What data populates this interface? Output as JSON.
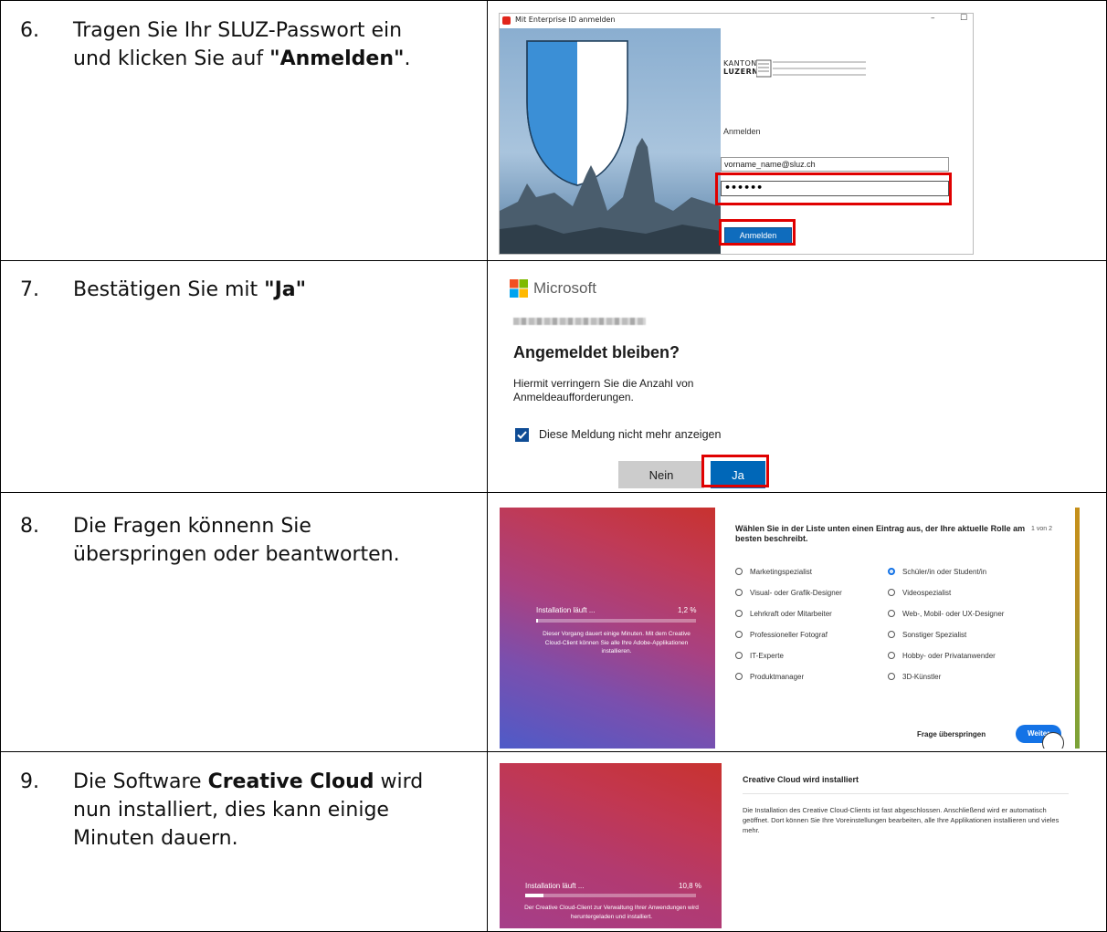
{
  "steps": [
    {
      "num": "6.",
      "pre": "Tragen Sie Ihr SLUZ-Passwort ein und klicken Sie auf ",
      "bold": "\"Anmelden\"",
      "post": "."
    },
    {
      "num": "7.",
      "pre": "Bestätigen Sie mit ",
      "bold": "\"Ja\"",
      "post": ""
    },
    {
      "num": "8.",
      "pre": "Die Fragen könnenn Sie überspringen oder beantworten.",
      "bold": "",
      "post": ""
    },
    {
      "num": "9.",
      "pre": "Die Software ",
      "bold": "Creative Cloud",
      "post": " wird nun installiert, dies kann einige Minuten dauern."
    }
  ],
  "s6": {
    "window_title": "Mit Enterprise ID anmelden",
    "logo_top": "KANTON",
    "logo_bottom": "LUZERN",
    "heading": "Anmelden",
    "email_value": "vorname_name@sluz.ch",
    "password_value": "••••••",
    "button": "Anmelden",
    "minimize": "–",
    "maximize": "☐"
  },
  "s7": {
    "brand": "Microsoft",
    "title": "Angemeldet bleiben?",
    "desc": "Hiermit verringern Sie die Anzahl von Anmeldeaufforderungen.",
    "checkbox": "Diese Meldung nicht mehr anzeigen",
    "no": "Nein",
    "yes": "Ja"
  },
  "s8": {
    "progress_label": "Installation läuft ...",
    "progress_pct": "1,2 %",
    "progress_value": 1.2,
    "info": "Dieser Vorgang dauert einige Minuten. Mit dem Creative Cloud-Client können Sie alle Ihre Adobe-Applikationen installieren.",
    "question": "Wählen Sie in der Liste unten einen Eintrag aus, der Ihre aktuelle Rolle am besten beschreibt.",
    "pager": "1 von 2",
    "options_left": [
      "Marketingspezialist",
      "Visual- oder Grafik-Designer",
      "Lehrkraft oder Mitarbeiter",
      "Professioneller Fotograf",
      "IT-Experte",
      "Produktmanager"
    ],
    "options_right": [
      "Schüler/in oder Student/in",
      "Videospezialist",
      "Web-, Mobil- oder UX-Designer",
      "Sonstiger Spezialist",
      "Hobby- oder Privatanwender",
      "3D-Künstler"
    ],
    "skip": "Frage überspringen",
    "next": "Weiter"
  },
  "s9": {
    "progress_label": "Installation läuft ...",
    "progress_pct": "10,8 %",
    "progress_value": 10.8,
    "info": "Der Creative Cloud-Client zur Verwaltung Ihrer Anwendungen wird heruntergeladen und installiert.",
    "title": "Creative Cloud wird installiert",
    "desc": "Die Installation des Creative Cloud-Clients ist fast abgeschlossen. Anschließend wird er automatisch geöffnet. Dort können Sie Ihre Voreinstellungen bearbeiten, alle Ihre Applikationen installieren und vieles mehr."
  },
  "colors": {
    "accent": "#0f6cbd",
    "highlight": "#e00000",
    "adobe_blue": "#1473e6"
  }
}
